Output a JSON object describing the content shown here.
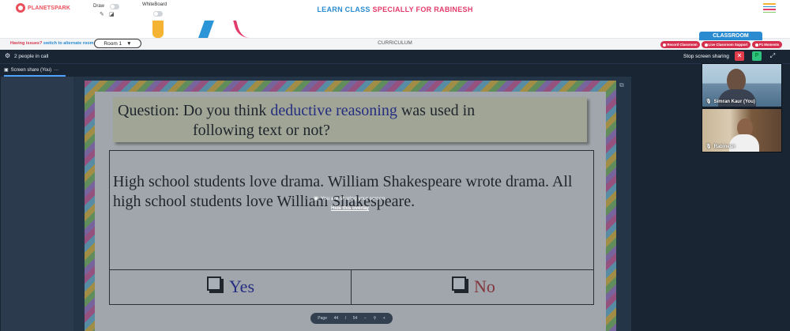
{
  "header": {
    "logo_text": "PLANETSPARK",
    "draw_label": "Draw",
    "whiteboard_label": "WhiteBoard",
    "title_part1": "LEARN CLASS",
    "title_part2": "SPECIALLY FOR RABINESH",
    "colors": {
      "blue": "#2a8bd0",
      "red": "#e23b6b"
    }
  },
  "subbar": {
    "issues_question": "Having issues?",
    "issues_link": "switch to alternate room",
    "room_label": "Room 1",
    "room_arrow": "▼",
    "curriculum_label": "CURRICULUM",
    "classroom_tab": "CLASSROOM",
    "buttons": [
      {
        "label": "Record Classroom"
      },
      {
        "label": "Live Classroom Support"
      },
      {
        "label": "P1 Moments"
      }
    ]
  },
  "meeting": {
    "people_count": "2 people in call",
    "stop_sharing": "Stop screen sharing",
    "p_badge": "P",
    "tab_label": "Screen share (You)",
    "tab_menu": "···"
  },
  "slide": {
    "question_prefix": "Question: Do you think",
    "question_highlight": "deductive reasoning",
    "question_suffix": "was used in",
    "question_line2": "following text or not?",
    "body_text": "High school students love drama.  William Shakespeare wrote drama.  All high school students love William Shakespeare.",
    "answer_yes": "Yes",
    "answer_no": "No"
  },
  "overlay": {
    "sharing_message": "You are sharing your screen",
    "hide_link": "Hide this overlay"
  },
  "pager": {
    "page_label": "Page",
    "current_page": "44",
    "separator": "/",
    "total_pages": "54"
  },
  "participants": [
    {
      "name": "Simran Kaur (You)"
    },
    {
      "name": "Rabinesh"
    }
  ]
}
